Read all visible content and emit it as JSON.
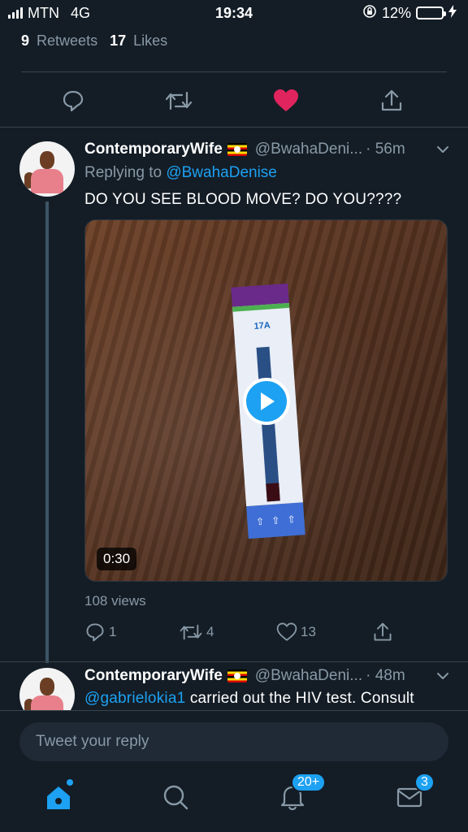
{
  "status": {
    "carrier": "MTN",
    "network": "4G",
    "time": "19:34",
    "battery": "12%",
    "battery_level": 0.12
  },
  "stats": {
    "retweets_count": "9",
    "retweets_label": "Retweets",
    "likes_count": "17",
    "likes_label": "Likes"
  },
  "main_actions": [
    "reply-icon",
    "retweet-icon",
    "heart-icon",
    "share-icon"
  ],
  "colors": {
    "background": "#141d26",
    "accent": "#1da1f2",
    "like": "#e0245e",
    "secondary_text": "#8899a6"
  },
  "tweets": [
    {
      "name": "ContemporaryWife",
      "handle": "@BwahaDeni...",
      "time": "· 56m",
      "replying_label": "Replying to",
      "replying_to": "@BwahaDenise",
      "text": "DO YOU SEE BLOOD MOVE?  DO YOU????",
      "media": {
        "duration": "0:30",
        "strip_label": "17A"
      },
      "views": "108 views",
      "reply_count": "1",
      "retweet_count": "4",
      "like_count": "13"
    },
    {
      "name": "ContemporaryWife",
      "handle": "@BwahaDeni...",
      "time": "· 48m",
      "mention": "@gabrielokia1",
      "text": " carried out the HIV test. Consult"
    }
  ],
  "reply": {
    "placeholder": "Tweet your reply"
  },
  "tabs": {
    "notifications_badge": "20+",
    "messages_badge": "3"
  }
}
